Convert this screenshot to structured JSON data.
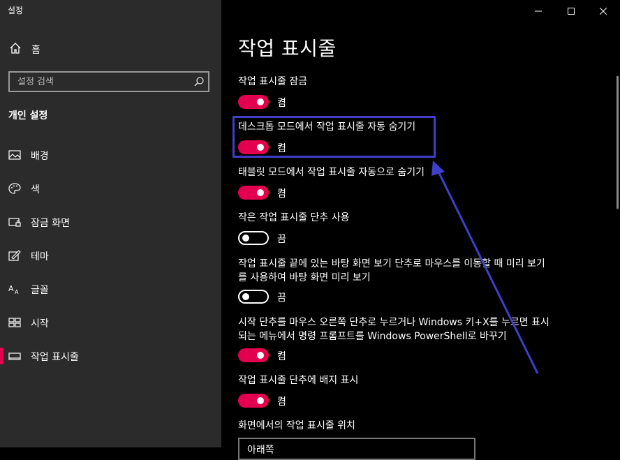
{
  "window": {
    "title": "설정"
  },
  "sidebar": {
    "home_label": "홈",
    "search_placeholder": "설정 검색",
    "section_title": "개인 설정",
    "items": [
      {
        "label": "배경",
        "icon": "image-icon"
      },
      {
        "label": "색",
        "icon": "palette-icon"
      },
      {
        "label": "잠금 화면",
        "icon": "lock-screen-icon"
      },
      {
        "label": "테마",
        "icon": "theme-icon"
      },
      {
        "label": "글꼴",
        "icon": "font-icon"
      },
      {
        "label": "시작",
        "icon": "start-icon"
      },
      {
        "label": "작업 표시줄",
        "icon": "taskbar-icon",
        "active": true
      }
    ]
  },
  "main": {
    "title": "작업 표시줄",
    "settings": [
      {
        "label": "작업 표시줄 잠금",
        "state": "켬",
        "on": true
      },
      {
        "label": "데스크톱 모드에서 작업 표시줄 자동 숨기기",
        "state": "켬",
        "on": true
      },
      {
        "label": "태블릿 모드에서 작업 표시줄 자동으로 숨기기",
        "state": "켬",
        "on": true
      },
      {
        "label": "작은 작업 표시줄 단추 사용",
        "state": "끔",
        "on": false
      },
      {
        "label": "작업 표시줄 끝에 있는 바탕 화면 보기 단추로 마우스를 이동할 때 미리 보기를 사용하여 바탕 화면 미리 보기",
        "state": "끔",
        "on": false
      },
      {
        "label": "시작 단추를 마우스 오른쪽 단추로 누르거나 Windows 키+X를 누르면 표시되는 메뉴에서 명령 프롬프트를 Windows PowerShell로 바꾸기",
        "state": "켬",
        "on": true
      },
      {
        "label": "작업 표시줄 단추에 배지 표시",
        "state": "켬",
        "on": true
      }
    ],
    "position_label": "화면에서의 작업 표시줄 위치",
    "position_value": "아래쪽"
  },
  "colors": {
    "accent": "#e3004f",
    "annotation": "#3f3fc8",
    "sidebar_bg": "#2b2b2b",
    "content_bg": "#000000"
  }
}
